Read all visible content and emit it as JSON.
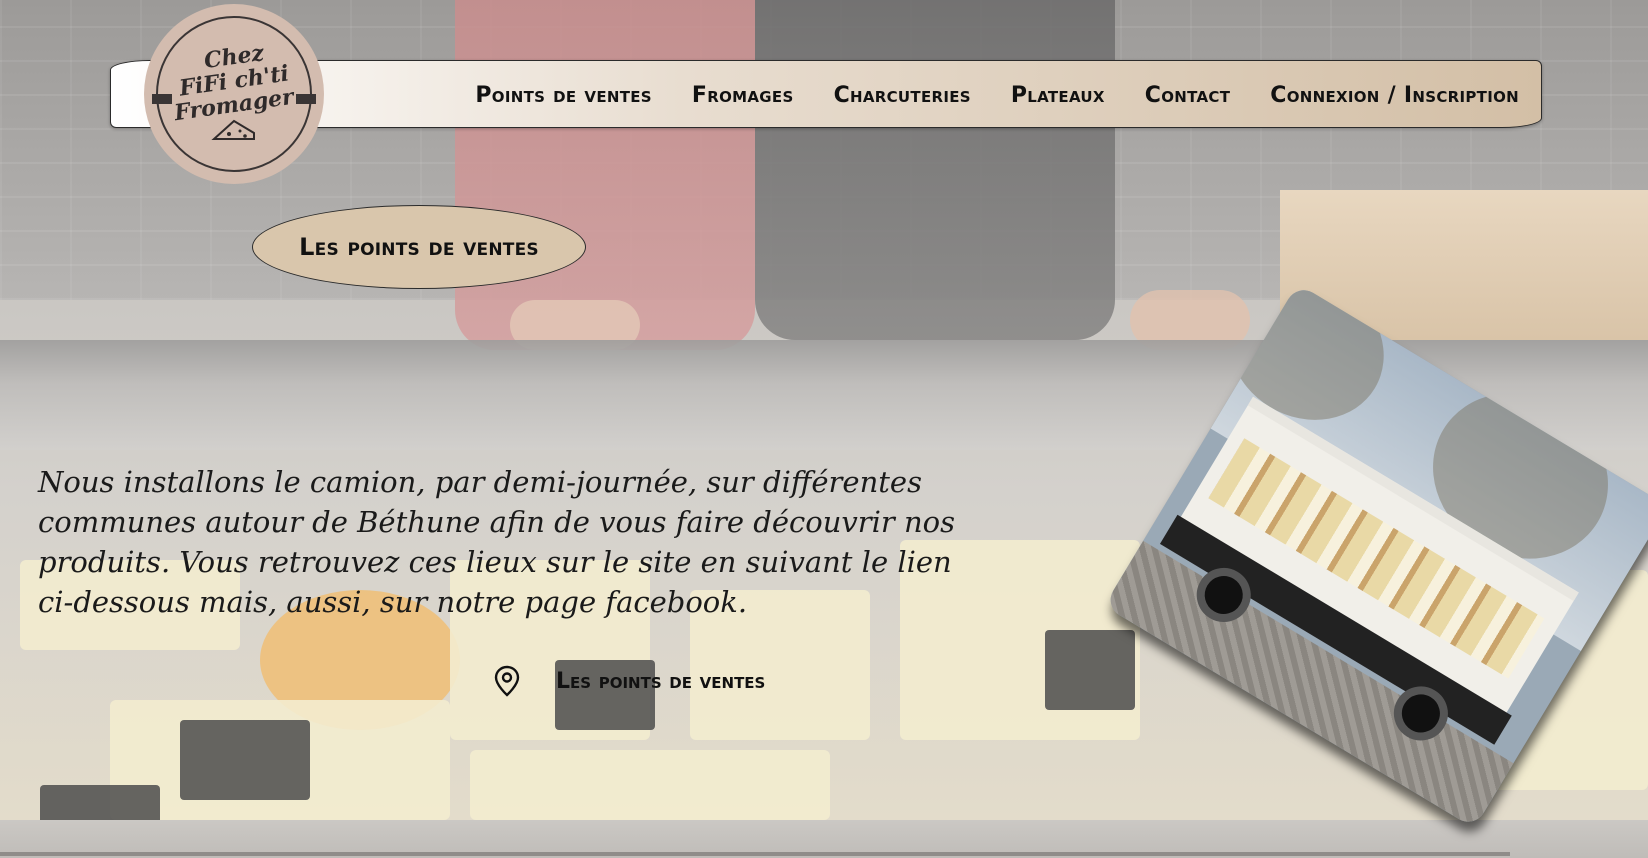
{
  "brand": {
    "logo_line1": "Chez",
    "logo_line2": "FiFi ch'ti",
    "logo_line3": "Fromager"
  },
  "nav": {
    "items": [
      {
        "label": "Points de ventes"
      },
      {
        "label": "Fromages"
      },
      {
        "label": "Charcuteries"
      },
      {
        "label": "Plateaux"
      },
      {
        "label": "Contact"
      },
      {
        "label": "Connexion / Inscription"
      }
    ]
  },
  "section": {
    "title": "Les points de ventes"
  },
  "main": {
    "description": "Nous installons le camion, par demi-journée, sur différentes communes autour de Béthune afin de vous faire découvrir nos produits. Vous retrouvez ces lieux sur le site en suivant le lien ci-dessous mais, aussi, sur notre page facebook.",
    "link_icon": "location-pin-icon",
    "link_label": "Les points de ventes"
  },
  "photo": {
    "subject": "cheese market truck"
  },
  "colors": {
    "accent_beige": "#d9c6ac",
    "logo_pink": "#d3bcaf",
    "text_dark": "#111111"
  }
}
